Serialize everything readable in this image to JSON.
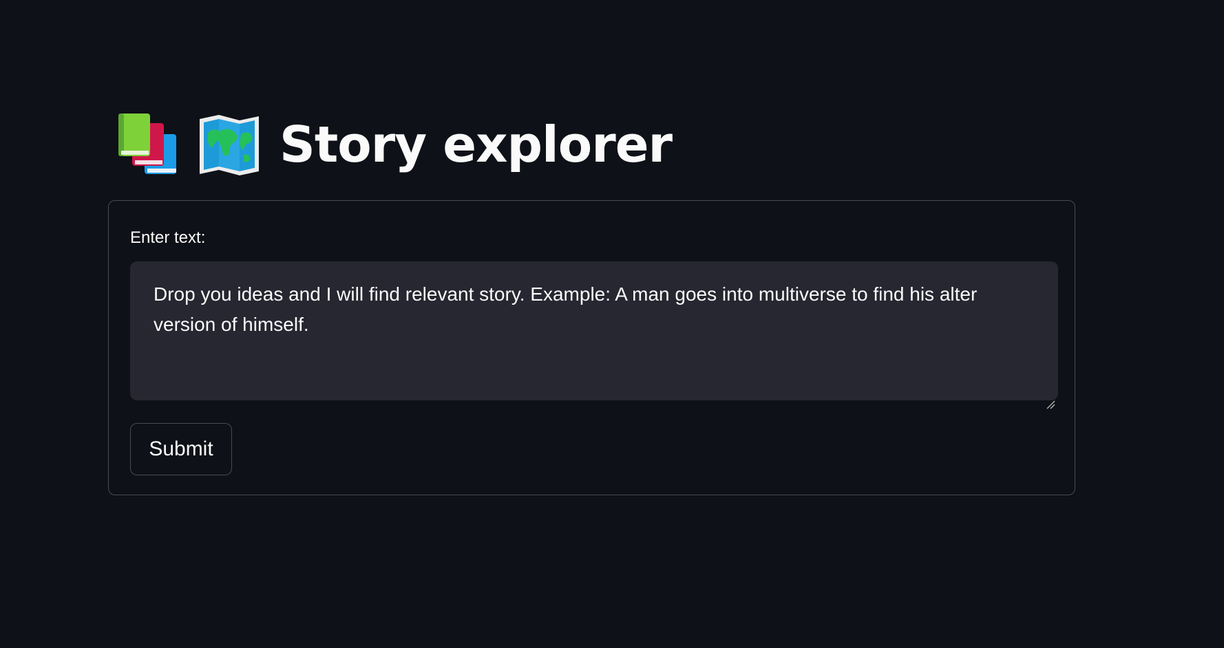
{
  "header": {
    "title": "Story explorer",
    "icons": [
      "books-icon",
      "world-map-icon"
    ]
  },
  "form": {
    "field_label": "Enter text:",
    "textarea_value": "Drop you ideas and I will find relevant story. Example: A man goes into multiverse to find his alter version of himself.",
    "submit_label": "Submit"
  },
  "colors": {
    "background": "#0e1117",
    "input_background": "#262730",
    "text": "#fafafa"
  }
}
